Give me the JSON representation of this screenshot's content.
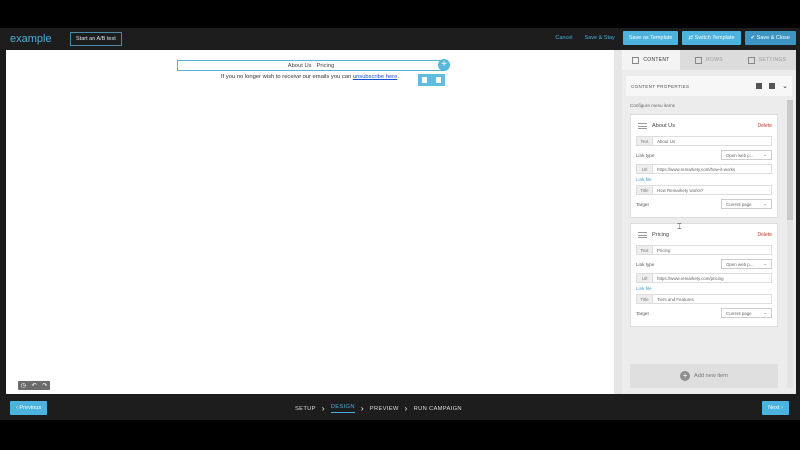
{
  "header": {
    "brand": "example",
    "ab_test_label": "Start an A/B test",
    "cancel_label": "Cancel",
    "save_stay_label": "Save & Stay",
    "save_template_label": "Save as Template",
    "switch_template_label": "Switch Template",
    "save_close_label": "Save & Close"
  },
  "canvas": {
    "menu_items": [
      "About Us",
      "Pricing"
    ],
    "unsubscribe_prefix": "If you no longer wish to receive our emails you can ",
    "unsubscribe_link": "unsubscribe here",
    "unsubscribe_suffix": "."
  },
  "side_panel": {
    "tabs": [
      {
        "label": "CONTENT",
        "icon": "content-grid-icon",
        "active": true
      },
      {
        "label": "ROWS",
        "icon": "rows-icon",
        "active": false
      },
      {
        "label": "SETTINGS",
        "icon": "settings-icon",
        "active": false
      }
    ],
    "props_title": "CONTENT PROPERTIES",
    "configure_label": "Configure menu items",
    "items": [
      {
        "name": "About Us",
        "delete_label": "Delete",
        "text_label": "Text",
        "text_value": "About Us",
        "link_type_label": "Link type",
        "link_type_value": "Open web p...",
        "url_label": "Url",
        "url_value": "https://www.remarkety.com/how-it-works",
        "link_file_label": "Link file",
        "title_label": "Title",
        "title_value": "How Remarkety works?",
        "target_label": "Target",
        "target_value": "Current page"
      },
      {
        "name": "Pricing",
        "delete_label": "Delete",
        "text_label": "Text",
        "text_value": "Pricing",
        "link_type_label": "Link type",
        "link_type_value": "Open web p...",
        "url_label": "Url",
        "url_value": "https://www.remarkety.com/pricing",
        "link_file_label": "Link file",
        "title_label": "Title",
        "title_value": "Tiers and Features",
        "target_label": "Target",
        "target_value": "Current page"
      }
    ],
    "add_item_label": "Add new item"
  },
  "footer": {
    "previous_label": "Previous",
    "next_label": "Next",
    "steps": [
      "SETUP",
      "DESIGN",
      "PREVIEW",
      "RUN CAMPAIGN"
    ],
    "active_step": "DESIGN"
  },
  "colors": {
    "accent": "#4bb3de",
    "dark_bg": "#1d1d1d",
    "delete_red": "#c0392b"
  }
}
